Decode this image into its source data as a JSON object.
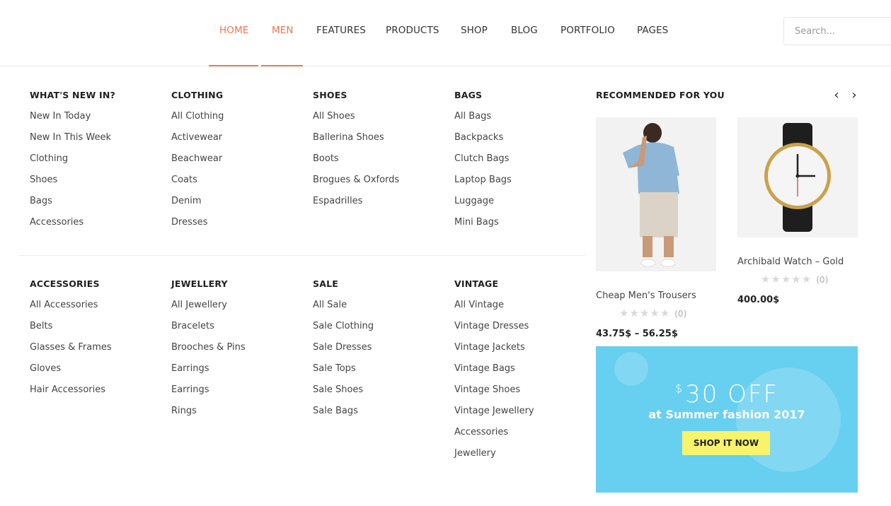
{
  "nav": {
    "items": [
      {
        "label": "HOME",
        "active": true
      },
      {
        "label": "MEN",
        "active": true
      },
      {
        "label": "FEATURES",
        "active": false
      },
      {
        "label": "PRODUCTS",
        "active": false
      },
      {
        "label": "SHOP",
        "active": false
      },
      {
        "label": "BLOG",
        "active": false
      },
      {
        "label": "PORTFOLIO",
        "active": false
      },
      {
        "label": "PAGES",
        "active": false
      }
    ],
    "accent_color": "#f0744f"
  },
  "search": {
    "placeholder": "Search..."
  },
  "mega_menu": {
    "columns": [
      {
        "title": "WHAT'S NEW IN?",
        "items": [
          "New In Today",
          "New In This Week",
          "Clothing",
          "Shoes",
          "Bags",
          "Accessories"
        ]
      },
      {
        "title": "CLOTHING",
        "items": [
          "All Clothing",
          "Activewear",
          "Beachwear",
          "Coats",
          "Denim",
          "Dresses"
        ]
      },
      {
        "title": "SHOES",
        "items": [
          "All Shoes",
          "Ballerina Shoes",
          "Boots",
          "Brogues & Oxfords",
          "Espadrilles"
        ]
      },
      {
        "title": "BAGS",
        "items": [
          "All Bags",
          "Backpacks",
          "Clutch Bags",
          "Laptop Bags",
          "Luggage",
          "Mini Bags"
        ]
      },
      {
        "title": "ACCESSORIES",
        "items": [
          "All Accessories",
          "Belts",
          "Glasses & Frames",
          "Gloves",
          "Hair Accessories"
        ]
      },
      {
        "title": "JEWELLERY",
        "items": [
          "All Jewellery",
          "Bracelets",
          "Brooches & Pins",
          "Earrings",
          "Earrings",
          "Rings"
        ]
      },
      {
        "title": "SALE",
        "items": [
          "All Sale",
          "Sale Clothing",
          "Sale Dresses",
          "Sale Tops",
          "Sale Shoes",
          "Sale Bags"
        ]
      },
      {
        "title": "VINTAGE",
        "items": [
          "All Vintage",
          "Vintage Dresses",
          "Vintage Jackets",
          "Vintage Bags",
          "Vintage Shoes",
          "Vintage Jewellery",
          "Accessories",
          "Jewellery"
        ]
      }
    ]
  },
  "recommended": {
    "title": "RECOMMENDED FOR YOU",
    "prev_icon": "‹",
    "next_icon": "›",
    "products": [
      {
        "name": "Cheap Men's Trousers",
        "stars": "★★★★★",
        "rating_count": "(0)",
        "price": "43.75$ – 56.25$",
        "image": "man-in-blue-shirt-photo"
      },
      {
        "name": "Archibald Watch – Gold",
        "stars": "★★★★★",
        "rating_count": "(0)",
        "price": "400.00$",
        "image": "wrist-watch-photo"
      }
    ]
  },
  "banner": {
    "currency": "$",
    "headline": "30 OFF",
    "subline": "at Summer fashion 2017",
    "button_label": "SHOP IT NOW",
    "background_color": "#67cfef",
    "button_color": "#f7f36a"
  }
}
